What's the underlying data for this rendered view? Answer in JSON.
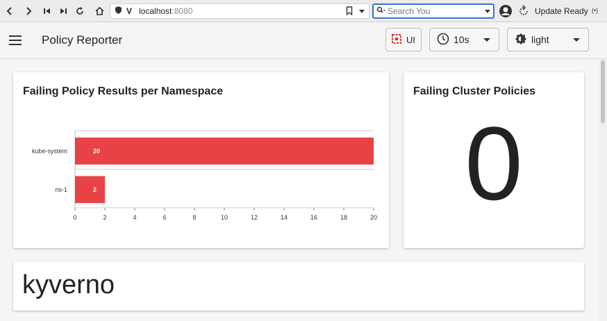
{
  "browser": {
    "url_host": "localhost",
    "url_port": ":8080",
    "search_placeholder": "Search You",
    "update_text": "Update Ready"
  },
  "header": {
    "title": "Policy Reporter",
    "ui_label": "UI",
    "refresh_value": "10s",
    "theme_value": "light"
  },
  "namespace_card": {
    "title": "Failing Policy Results per Namespace"
  },
  "cluster_card": {
    "title": "Failing Cluster Policies",
    "count": "0"
  },
  "kyverno_card": {
    "title": "kyverno"
  },
  "colors": {
    "bar": "#e84146",
    "accent": "#d33"
  },
  "chart_data": {
    "type": "bar",
    "orientation": "horizontal",
    "categories": [
      "kube-system",
      "ns-1"
    ],
    "values": [
      20,
      2
    ],
    "data_labels": [
      "20",
      "2"
    ],
    "x_ticks": [
      "0",
      "2",
      "4",
      "6",
      "8",
      "10",
      "12",
      "14",
      "16",
      "18",
      "20"
    ],
    "xlim": [
      0,
      20
    ],
    "title": "Failing Policy Results per Namespace"
  }
}
